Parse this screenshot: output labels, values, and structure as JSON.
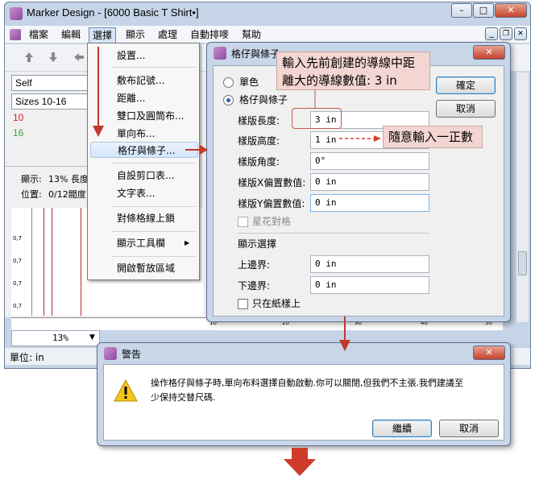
{
  "window": {
    "title": "Marker Design - [6000 Basic T Shirt•]",
    "icon": "app-logo-icon",
    "controls": [
      "–",
      "□",
      "✕"
    ]
  },
  "menubar": {
    "items": [
      "檔案",
      "編輯",
      "選擇",
      "顯示",
      "處理",
      "自動排嘜",
      "幫助"
    ],
    "active": "選擇",
    "mdi_controls": [
      "_",
      "❐",
      "✕"
    ]
  },
  "left_panel": {
    "select1": "Self",
    "select2": "Sizes 10-16",
    "size_a": "10",
    "size_b": "16",
    "size_a_color": "#d2291b",
    "size_b_color": "#3aa23a",
    "display_label": "顯示:",
    "display_value": "13% 長度",
    "position_label": "位置:",
    "position_value": "0/12閥度"
  },
  "ruler_v_ticks": [
    "0,7",
    "0,7",
    "0,7",
    "0,7"
  ],
  "ruler_h_ticks": [
    "10",
    "20",
    "30",
    "40",
    "50"
  ],
  "zoom_value": "13%",
  "status_unit": "單位: in",
  "dropdown": {
    "items": [
      "設置...",
      "敷布記號...",
      "距離...",
      "雙口及圓筒布...",
      "單向布...",
      "格仔與條子...",
      "自設剪口表...",
      "文字表...",
      "對條格線上鎖",
      "顯示工具欄",
      "開啟暫放區域"
    ],
    "highlighted": "格仔與條子...",
    "submenu_arrow": "▶"
  },
  "grid_dialog": {
    "title": "格仔與條子",
    "radio_single": "單色",
    "radio_grid": "格仔與條子",
    "fields": [
      {
        "label": "樣版長度:",
        "value": "3 in"
      },
      {
        "label": "樣版高度:",
        "value": "1 in"
      },
      {
        "label": "樣版角度:",
        "value": "0°"
      },
      {
        "label": "樣版X偏置數值:",
        "value": "0 in"
      },
      {
        "label": "樣版Y偏置數值:",
        "value": "0 in"
      }
    ],
    "star_check": "星花對格",
    "display_section": "顯示選擇",
    "top_margin_label": "上邊界:",
    "top_margin_value": "0 in",
    "bottom_margin_label": "下邊界:",
    "bottom_margin_value": "0 in",
    "only_on_paper": "只在紙樣上",
    "ok_button": "確定",
    "cancel_button": "取消"
  },
  "warning_dialog": {
    "title": "警告",
    "message_line1": "操作格仔與條子時,單向布料選擇自動啟動.你可以關閉,但我們不主張.我們建議至",
    "message_line2": "少保持交替尺碼.",
    "continue_button": "繼續",
    "cancel_button": "取消"
  },
  "annotations": {
    "callout_top_line1": "輸入先前創建的導線中距",
    "callout_top_line2": "離大的導線數值: 3 in",
    "callout_right": "隨意輸入一正數",
    "arrow_color": "#c0392b",
    "callout_color": "#f3d6d1"
  }
}
